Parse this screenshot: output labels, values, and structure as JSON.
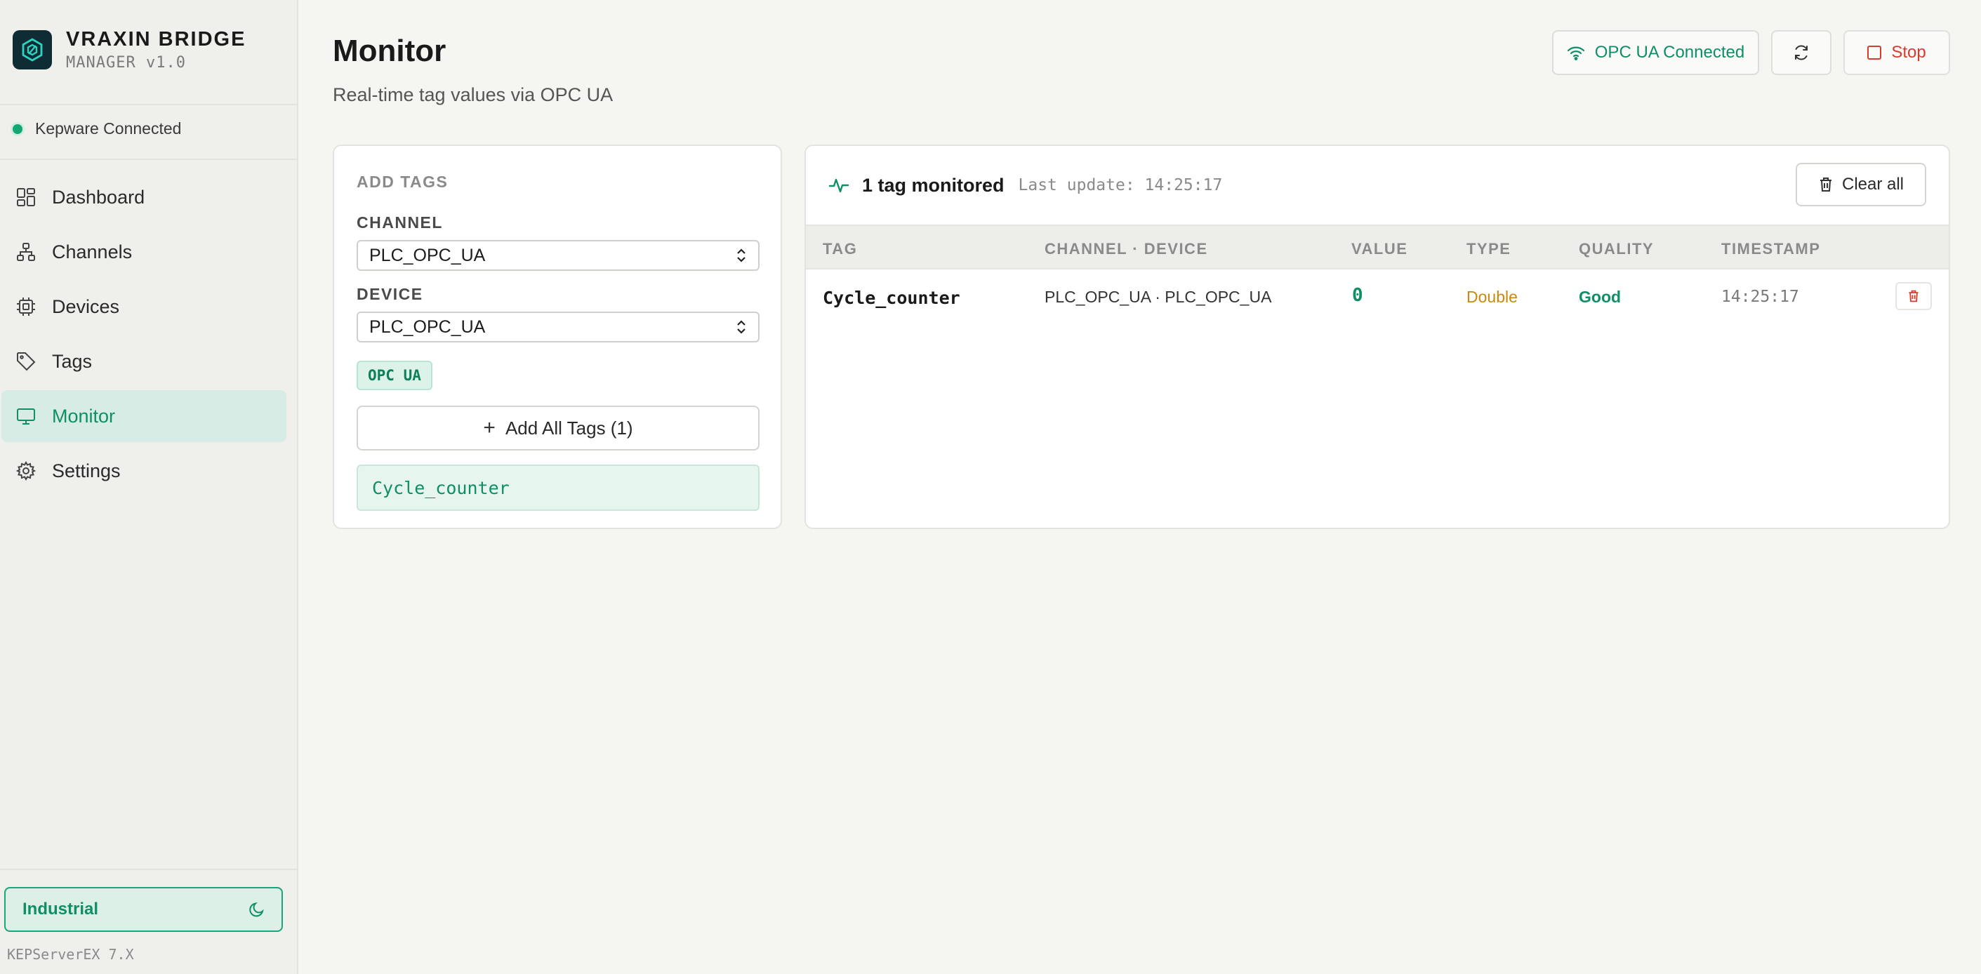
{
  "brand": {
    "title": "VRAXIN BRIDGE",
    "subtitle": "MANAGER v1.0"
  },
  "connection": {
    "label": "Kepware Connected",
    "color": "#12a874"
  },
  "nav": [
    {
      "label": "Dashboard",
      "icon": "dashboard-icon"
    },
    {
      "label": "Channels",
      "icon": "network-icon"
    },
    {
      "label": "Devices",
      "icon": "chip-icon"
    },
    {
      "label": "Tags",
      "icon": "tag-icon"
    },
    {
      "label": "Monitor",
      "icon": "monitor-icon",
      "active": true
    },
    {
      "label": "Settings",
      "icon": "gear-icon"
    }
  ],
  "theme": {
    "label": "Industrial",
    "icon": "moon-icon"
  },
  "footer": {
    "version": "KEPServerEX 7.X"
  },
  "page": {
    "title": "Monitor",
    "subtitle": "Real-time tag values via OPC UA"
  },
  "toolbar": {
    "connection_label": "OPC UA Connected",
    "refresh_icon": "refresh-icon",
    "stop_label": "Stop"
  },
  "add_tags": {
    "heading": "ADD TAGS",
    "channel_label": "CHANNEL",
    "channel_value": "PLC_OPC_UA",
    "device_label": "DEVICE",
    "device_value": "PLC_OPC_UA",
    "protocol_badge": "OPC UA",
    "add_all_label": "Add All Tags (1)",
    "tags": [
      "Cycle_counter"
    ]
  },
  "monitor": {
    "count_label": "1 tag monitored",
    "last_update": "Last update: 14:25:17",
    "clear_label": "Clear all",
    "columns": [
      "TAG",
      "CHANNEL · DEVICE",
      "VALUE",
      "TYPE",
      "QUALITY",
      "TIMESTAMP"
    ],
    "rows": [
      {
        "tag": "Cycle_counter",
        "channel_device": "PLC_OPC_UA · PLC_OPC_UA",
        "value": "0",
        "type": "Double",
        "quality": "Good",
        "timestamp": "14:25:17"
      }
    ]
  },
  "colors": {
    "accent": "#0e8f66",
    "danger": "#d63b2f",
    "warning": "#c98a0b"
  }
}
